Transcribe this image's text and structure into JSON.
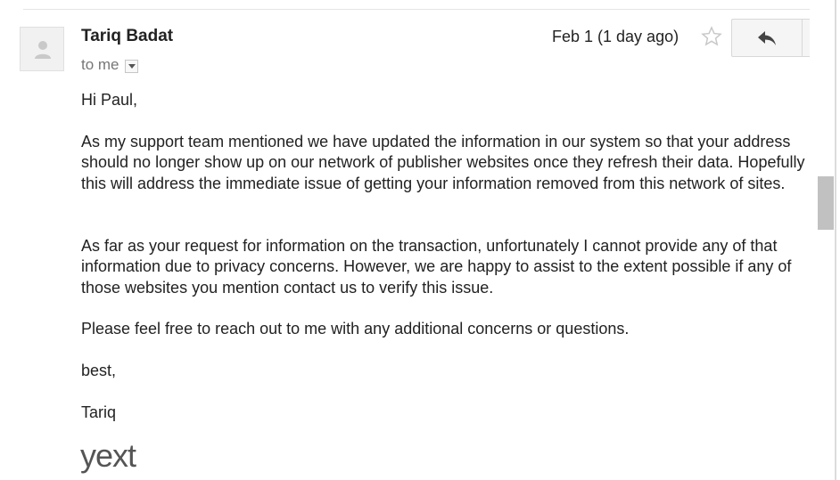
{
  "message": {
    "sender_name": "Tariq Badat",
    "recipient_label": "to me",
    "date": "Feb 1 (1 day ago)",
    "body": {
      "greeting": "Hi Paul,",
      "paragraph_1": "As my support team mentioned we have updated the information in our system so that your address should no longer show up on our network of publisher websites once they refresh their data. Hopefully this will address the immediate issue of getting your information removed from this network of sites.",
      "paragraph_2": "As far as your request for information on the transaction, unfortunately I cannot provide any of that information due to privacy concerns. However, we are happy to assist to the extent possible if any of those websites you mention contact us to verify this issue.",
      "paragraph_3": "Please feel free to reach out to me with any additional concerns or questions.",
      "closing": "best,",
      "signature_name": "Tariq",
      "signature_logo": "yext"
    }
  },
  "icons": {
    "avatar": "avatar-placeholder-icon",
    "details": "chevron-down-icon",
    "star": "star-outline-icon",
    "reply": "reply-arrow-icon"
  },
  "colors": {
    "text": "#222222",
    "muted": "#777777",
    "star": "#c8c8c8",
    "button_bg": "#f5f5f5",
    "scrollbar_thumb": "#c1c1c1"
  }
}
